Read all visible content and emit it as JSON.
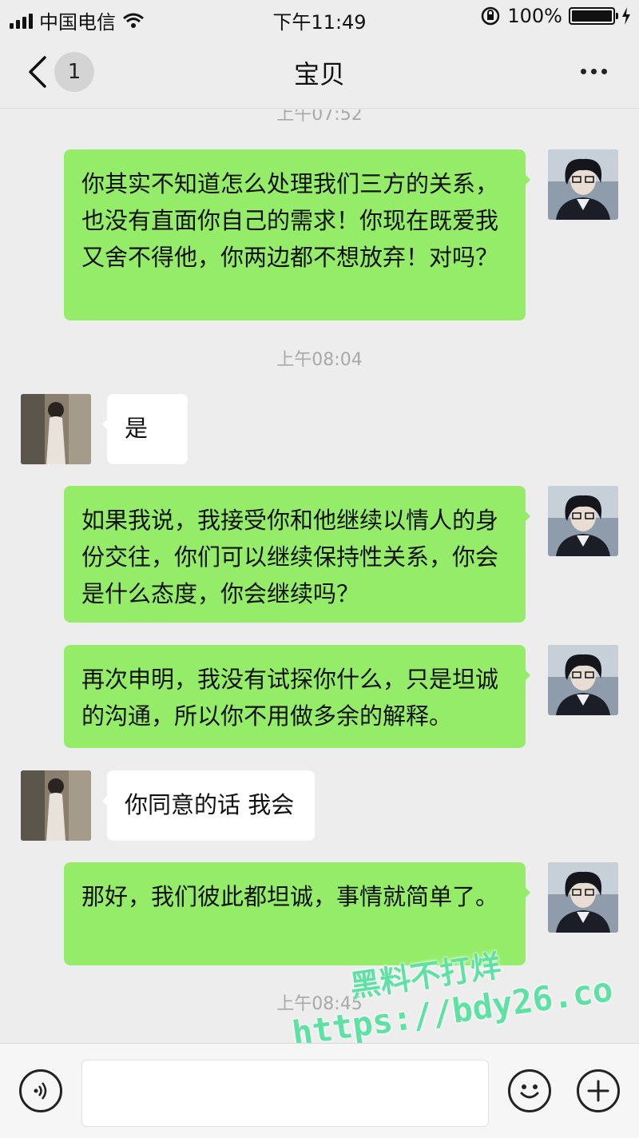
{
  "status_bar": {
    "carrier": "中国电信",
    "time": "下午11:49",
    "battery": "100%"
  },
  "nav": {
    "unread_count": "1",
    "title": "宝贝"
  },
  "messages": [
    {
      "type": "timestamp",
      "text": "上午07:52"
    },
    {
      "type": "sent",
      "text": "你其实不知道怎么处理我们三方的关系，也没有直面你自己的需求！你现在既爱我又舍不得他，你两边都不想放弃！对吗？"
    },
    {
      "type": "timestamp",
      "text": "上午08:04"
    },
    {
      "type": "received",
      "text": "是"
    },
    {
      "type": "sent",
      "text": "如果我说，我接受你和他继续以情人的身份交往，你们可以继续保持性关系，你会是什么态度，你会继续吗？"
    },
    {
      "type": "sent",
      "text": "再次申明，我没有试探你什么，只是坦诚的沟通，所以你不用做多余的解释。"
    },
    {
      "type": "received",
      "text": "你同意的话 我会"
    },
    {
      "type": "sent",
      "text": "那好，我们彼此都坦诚，事情就简单了。"
    },
    {
      "type": "timestamp",
      "text": "上午08:45"
    }
  ],
  "watermark": {
    "line1": "黑料不打烊",
    "line2": "https://bdy26.co"
  },
  "input": {
    "value": ""
  },
  "icons": {
    "voice": "voice-icon",
    "emoji": "emoji-icon",
    "more": "plus-icon"
  }
}
